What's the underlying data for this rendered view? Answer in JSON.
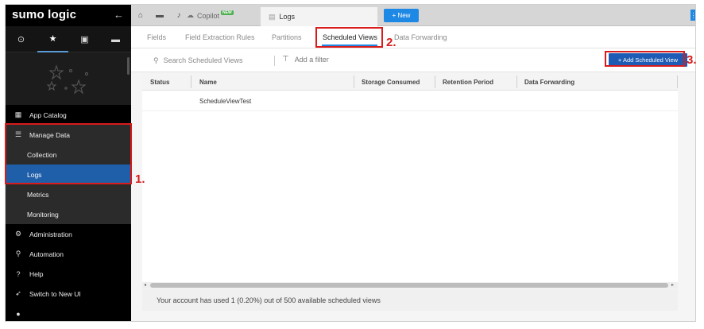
{
  "sidebar": {
    "brand": "sumo logic",
    "collapse_icon": "arrow-left-icon",
    "tabs": [
      {
        "icon": "clock-icon",
        "glyph": "⊙"
      },
      {
        "icon": "star-icon",
        "glyph": "★"
      },
      {
        "icon": "user-folder-icon",
        "glyph": "▣"
      },
      {
        "icon": "folder-icon",
        "glyph": "▬"
      }
    ],
    "items": [
      {
        "label": "App Catalog",
        "icon": "grid-icon",
        "glyph": "▦"
      },
      {
        "label": "Manage Data",
        "icon": "database-icon",
        "glyph": "☰"
      },
      {
        "label": "Collection",
        "icon": "",
        "glyph": ""
      },
      {
        "label": "Logs",
        "icon": "",
        "glyph": ""
      },
      {
        "label": "Metrics",
        "icon": "",
        "glyph": ""
      },
      {
        "label": "Monitoring",
        "icon": "",
        "glyph": ""
      },
      {
        "label": "Administration",
        "icon": "gear-icon",
        "glyph": "⚙"
      },
      {
        "label": "Automation",
        "icon": "automation-icon",
        "glyph": "⚲"
      },
      {
        "label": "Help",
        "icon": "help-icon",
        "glyph": "?"
      },
      {
        "label": "Switch to New UI",
        "icon": "rocket-icon",
        "glyph": "➶"
      },
      {
        "label": "",
        "icon": "user-icon",
        "glyph": "●"
      }
    ]
  },
  "topbar": {
    "home_glyph": "⌂",
    "folder_glyph": "▬",
    "bell_glyph": "♪",
    "copilot_label": "Copilot",
    "copilot_badge": "NEW",
    "logs_tab_label": "Logs",
    "new_button_label": "+ New",
    "kebab_glyph": "⋮"
  },
  "subtabs": [
    "Fields",
    "Field Extraction Rules",
    "Partitions",
    "Scheduled Views",
    "Data Forwarding"
  ],
  "toolbar": {
    "search_placeholder": "Search Scheduled Views",
    "add_filter_label": "Add a filter",
    "add_button_label": "+ Add Scheduled View"
  },
  "table": {
    "columns": [
      "Status",
      "Name",
      "Storage Consumed",
      "Retention Period",
      "Data Forwarding"
    ],
    "rows": [
      {
        "status": "",
        "name": "ScheduleViewTest",
        "storage": "",
        "retention": "",
        "forwarding": ""
      }
    ]
  },
  "footer": {
    "text": "Your account has used 1 (0.20%) out of 500 available scheduled views"
  },
  "annotations": [
    "1.",
    "2.",
    "3."
  ],
  "colors": {
    "accent": "#1e88e5",
    "selected": "#1f5ea8",
    "annotation": "#d81b1b"
  }
}
